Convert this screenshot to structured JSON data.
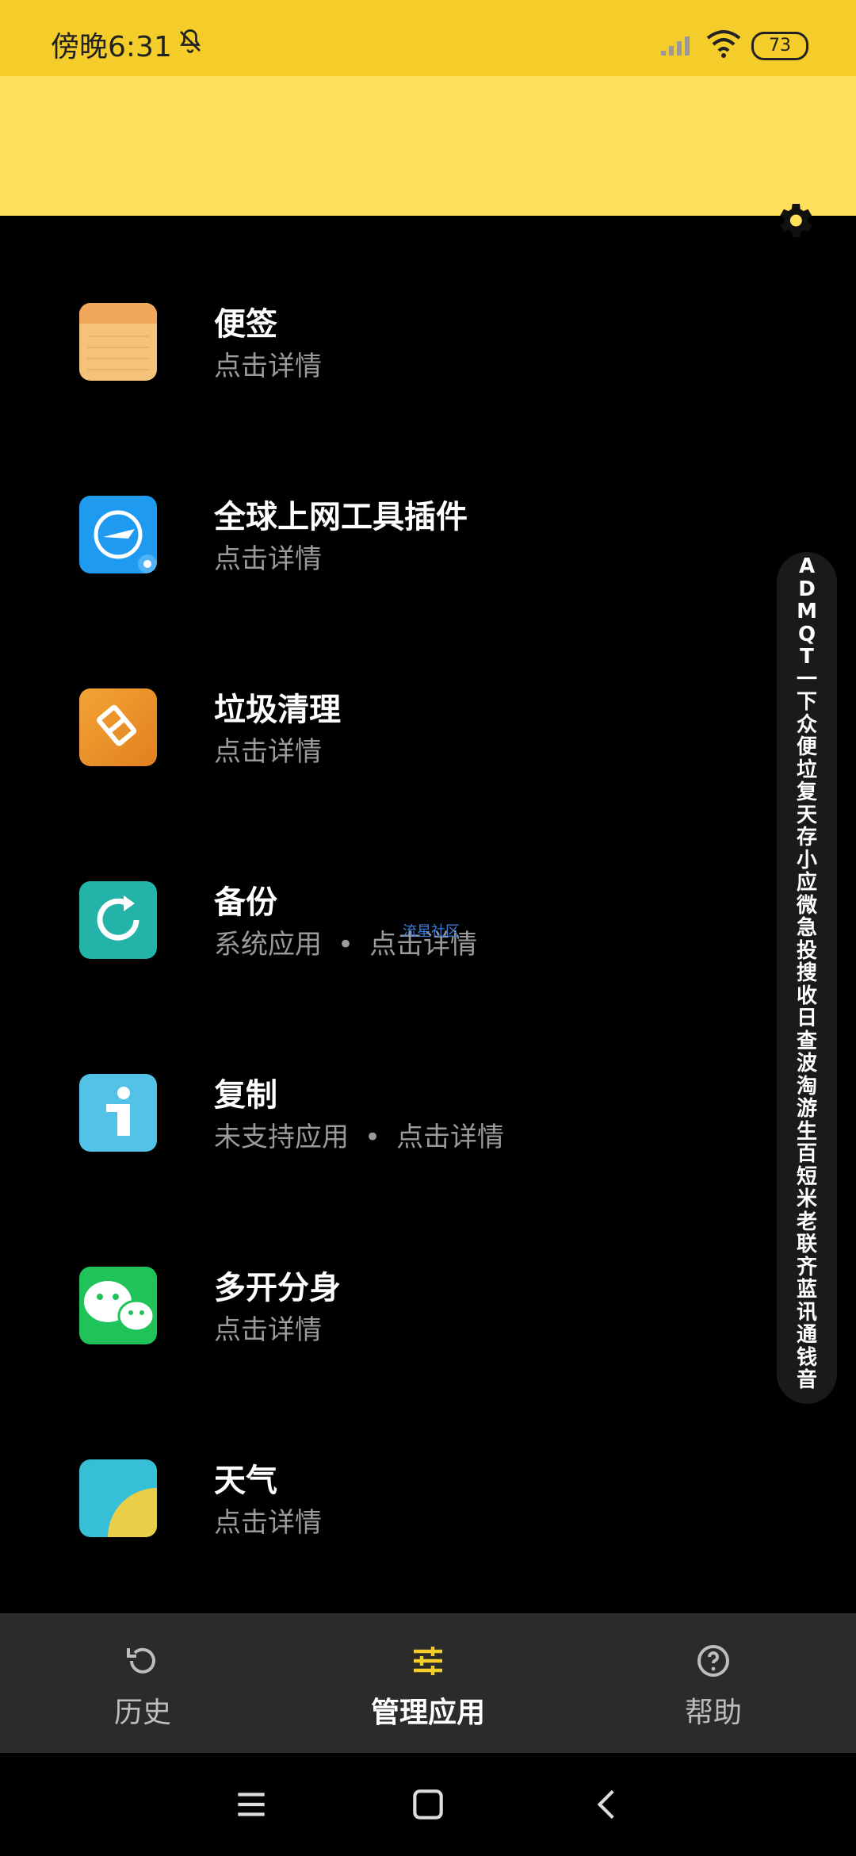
{
  "status_bar": {
    "time": "傍晚6:31",
    "battery": "73"
  },
  "apps": [
    {
      "title": "便签",
      "subtitle_parts": [
        "点击详情"
      ],
      "icon": "notes-icon"
    },
    {
      "title": "全球上网工具插件",
      "subtitle_parts": [
        "点击详情"
      ],
      "icon": "global-internet-icon"
    },
    {
      "title": "垃圾清理",
      "subtitle_parts": [
        "点击详情"
      ],
      "icon": "cleaner-icon"
    },
    {
      "title": "备份",
      "subtitle_parts": [
        "系统应用",
        "点击详情"
      ],
      "icon": "backup-icon"
    },
    {
      "title": "复制",
      "subtitle_parts": [
        "未支持应用",
        "点击详情"
      ],
      "icon": "info-copy-icon"
    },
    {
      "title": "多开分身",
      "subtitle_parts": [
        "点击详情"
      ],
      "icon": "wechat-dual-icon"
    },
    {
      "title": "天气",
      "subtitle_parts": [
        "点击详情"
      ],
      "icon": "weather-icon"
    }
  ],
  "separator": "•",
  "watermark": "流星社区",
  "index": [
    "A",
    "D",
    "M",
    "Q",
    "T",
    "一",
    "下",
    "众",
    "便",
    "垃",
    "复",
    "天",
    "存",
    "小",
    "应",
    "微",
    "急",
    "投",
    "搜",
    "收",
    "日",
    "查",
    "波",
    "淘",
    "游",
    "生",
    "百",
    "短",
    "米",
    "老",
    "联",
    "齐",
    "蓝",
    "讯",
    "通",
    "钱",
    "音"
  ],
  "bottom_nav": [
    {
      "label": "历史",
      "icon": "history-icon",
      "active": false
    },
    {
      "label": "管理应用",
      "icon": "sliders-icon",
      "active": true
    },
    {
      "label": "帮助",
      "icon": "help-icon",
      "active": false
    }
  ],
  "colors": {
    "status_bar": "#f5cd2a",
    "header": "#ffe05a",
    "accent": "#f5cd2a"
  }
}
